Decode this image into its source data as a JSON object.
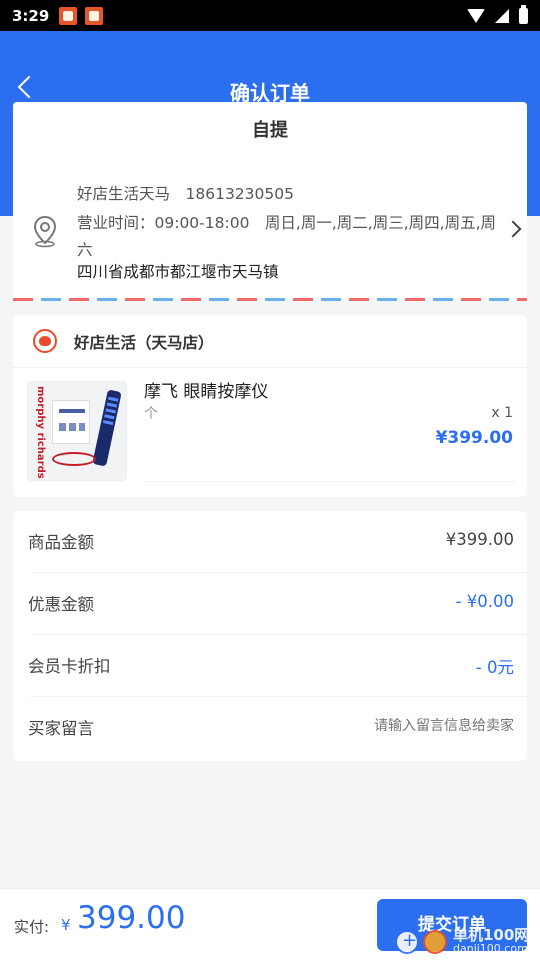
{
  "status_bar": {
    "time": "3:29"
  },
  "header": {
    "title": "确认订单"
  },
  "address": {
    "pickup_title": "自提",
    "name_phone": "好店生活天马　18613230505",
    "hours": "营业时间：09:00-18:00　周日,周一,周二,周三,周四,周五,周六",
    "address": "四川省成都市都江堰市天马镇"
  },
  "store": {
    "name": "好店生活（天马店）",
    "product": {
      "image_brand_text": "morphy richards",
      "name": "摩飞 眼睛按摩仪",
      "unit": "个",
      "qty": "x 1",
      "price": "¥399.00"
    }
  },
  "summary": {
    "goods_label": "商品金额",
    "goods_value": "¥399.00",
    "discount_label": "优惠金额",
    "discount_value": "- ¥0.00",
    "member_label": "会员卡折扣",
    "member_value": "- 0元",
    "note_label": "买家留言",
    "note_placeholder": "请输入留言信息给卖家"
  },
  "footer": {
    "pay_label": "实付:",
    "currency": "¥",
    "amount": "399.00",
    "submit_label": "提交订单"
  },
  "watermark": {
    "title": "单机100网",
    "sub": "danji100.com"
  },
  "colors": {
    "accent": "#2b6ff0",
    "background": "#f4f5f7"
  }
}
